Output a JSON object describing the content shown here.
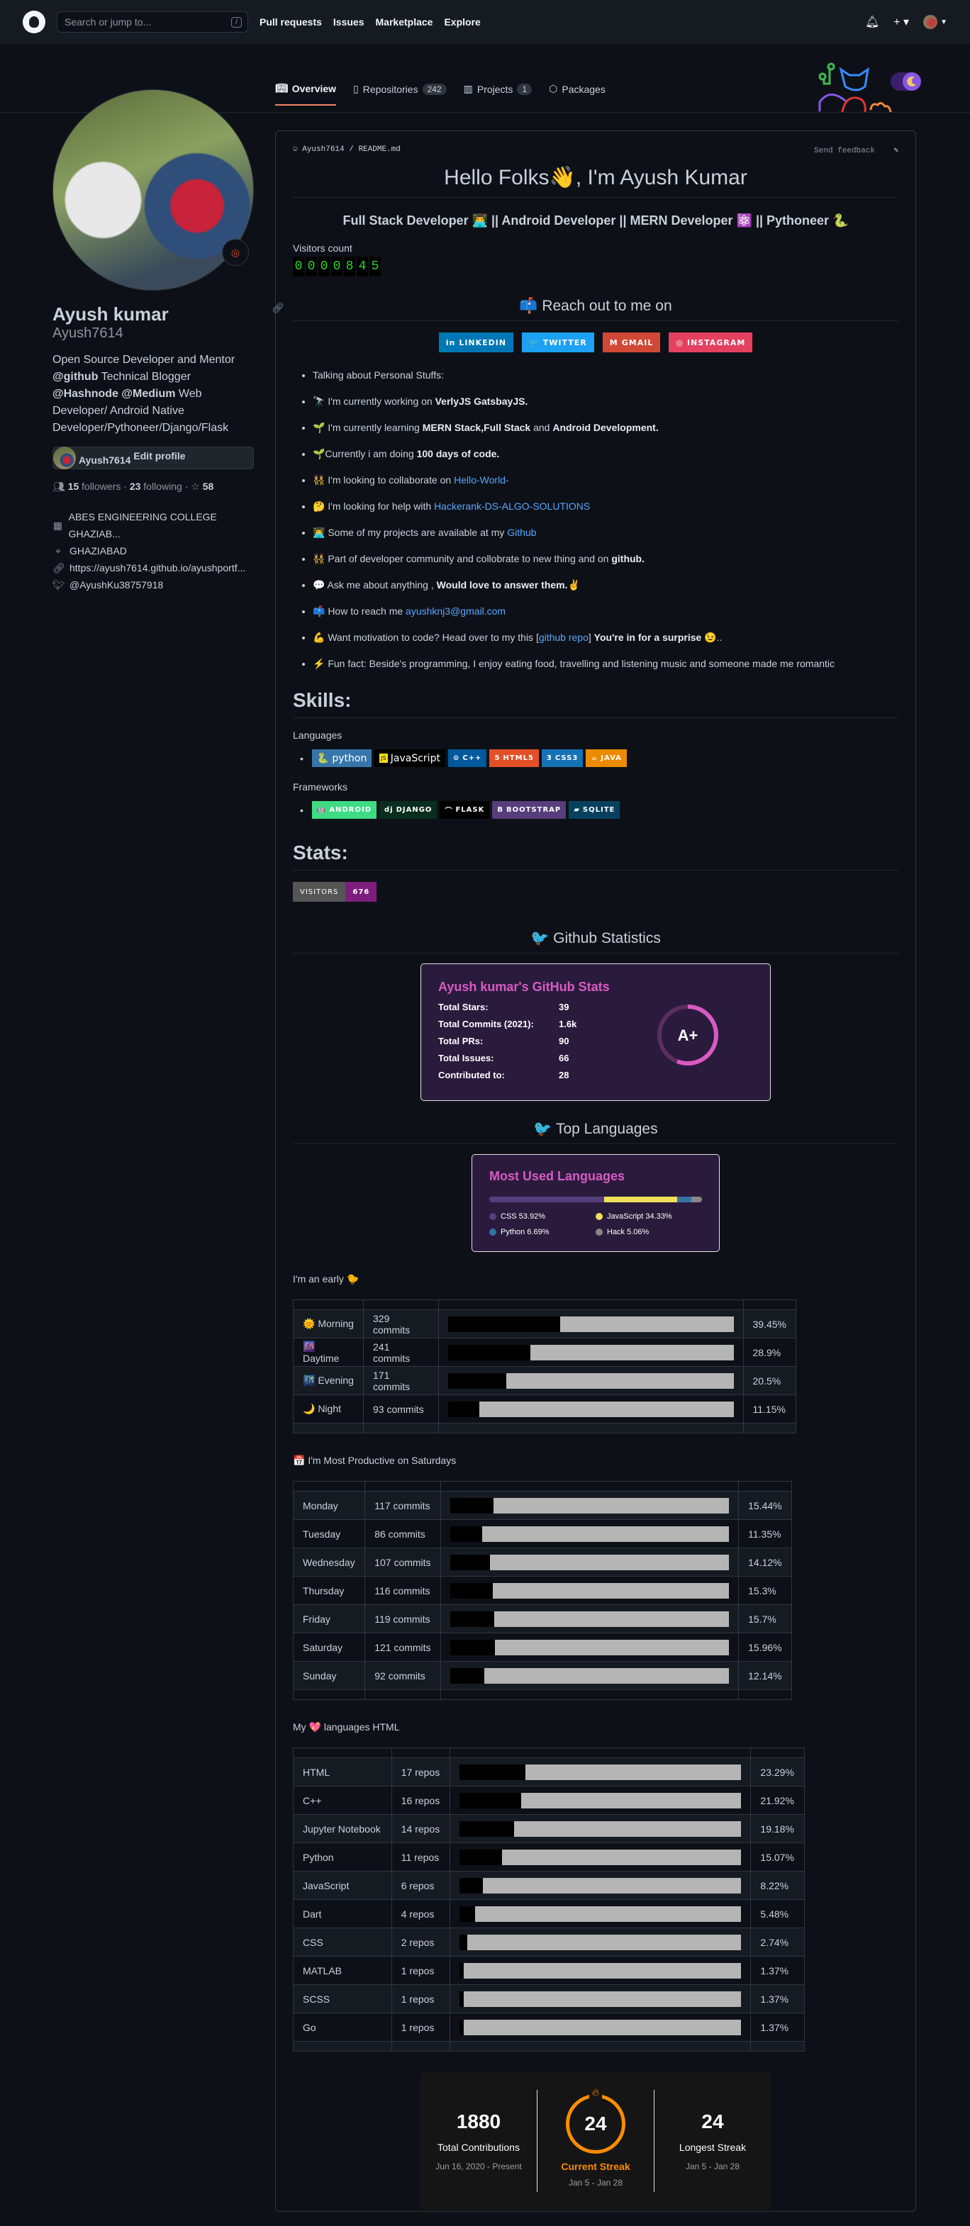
{
  "header": {
    "search_placeholder": "Search or jump to...",
    "slash": "/",
    "nav": [
      "Pull requests",
      "Issues",
      "Marketplace",
      "Explore"
    ]
  },
  "tabs": [
    {
      "label": "Overview"
    },
    {
      "label": "Repositories",
      "count": "242"
    },
    {
      "label": "Projects",
      "count": "1"
    },
    {
      "label": "Packages"
    }
  ],
  "profile": {
    "name": "Ayush kumar",
    "login": "Ayush7614",
    "bio_parts": [
      "Open Source Developer and Mentor ",
      "@github",
      " Technical Blogger ",
      "@Hashnode @Medium",
      " Web Developer/ Android Native Developer/Pythoneer/Django/Flask"
    ],
    "edit_label": "Edit profile",
    "followers": "15",
    "followers_label": "followers",
    "following": "23",
    "following_label": "following",
    "stars": "58",
    "org": "ABES ENGINEERING COLLEGE GHAZIAB...",
    "location": "GHAZIABAD",
    "website": "https://ayush7614.github.io/ayushportf...",
    "twitter": "@AyushKu38757918"
  },
  "readme": {
    "path_user": "Ayush7614",
    "path_file": "README.md",
    "send_feedback": "Send feedback",
    "title": "Hello Folks👋, I'm Ayush Kumar",
    "subtitle": "Full Stack Developer 👨‍💻 || Android Developer || MERN Developer ⚛️ || Pythoneer 🐍",
    "visitors_label": "Visitors count",
    "visitor_digits": [
      "0",
      "0",
      "0",
      "0",
      "8",
      "4",
      "5"
    ],
    "reach_title": "📫 Reach out to me on",
    "socials": [
      {
        "label": "LINKEDIN",
        "icon": "in",
        "color": "#0077b5"
      },
      {
        "label": "TWITTER",
        "icon": "🐦",
        "color": "#1da1f2"
      },
      {
        "label": "GMAIL",
        "icon": "M",
        "color": "#d14836"
      },
      {
        "label": "INSTAGRAM",
        "icon": "◎",
        "color": "#e4405f"
      }
    ],
    "about": [
      {
        "pre": "Talking about Personal Stuffs:"
      },
      {
        "pre": "🔭 I'm currently working on ",
        "bold": "VerlyJS GatsbayJS."
      },
      {
        "pre": "🌱 I'm currently learning ",
        "bold": "MERN Stack,Full Stack",
        "mid": " and ",
        "bold2": "Android Development."
      },
      {
        "pre": "🌱Currently i am doing ",
        "bold": "100 days of code."
      },
      {
        "pre": "👯 I'm looking to collaborate on ",
        "link": "Hello-World-"
      },
      {
        "pre": "🤔 I'm looking for help with ",
        "link": "Hackerank-DS-ALGO-SOLUTIONS"
      },
      {
        "pre": "👨‍💻 Some of my projects are available at my ",
        "link": "Github"
      },
      {
        "pre": "👯 Part of developer community and collobrate to new thing and on ",
        "bold": "github."
      },
      {
        "pre": "💬 Ask me about anything , ",
        "bold": "Would love to answer them.✌️"
      },
      {
        "pre": "📫 How to reach me ",
        "link": "ayushknj3@gmail.com"
      },
      {
        "pre": "💪 Want motivation to code? Head over to my this [",
        "link": "github repo",
        "mid": "] ",
        "bold": "You're in for a surprise 😉",
        "post": ".."
      },
      {
        "pre": "⚡ Fun fact: Beside's programming, I enjoy eating food, travelling and listening music and someone made me romantic"
      }
    ],
    "skills_title": "Skills:",
    "languages_label": "Languages",
    "frameworks_label": "Frameworks",
    "languages": [
      {
        "label": "python",
        "color": "#3776ab",
        "icon": "🐍"
      },
      {
        "label": "JavaScript",
        "color": "#000000",
        "icon": "JS"
      },
      {
        "label": "C++",
        "color": "#00599c",
        "icon": "⊙"
      },
      {
        "label": "HTML5",
        "color": "#e34f26",
        "icon": "5"
      },
      {
        "label": "CSS3",
        "color": "#1572b6",
        "icon": "3"
      },
      {
        "label": "JAVA",
        "color": "#ed8b00",
        "icon": "☕"
      }
    ],
    "frameworks": [
      {
        "label": "ANDROID",
        "color": "#3ddc84",
        "icon": "🤖"
      },
      {
        "label": "DJANGO",
        "color": "#092e20",
        "icon": "dj"
      },
      {
        "label": "FLASK",
        "color": "#000000",
        "icon": "⌒"
      },
      {
        "label": "BOOTSTRAP",
        "color": "#563d7c",
        "icon": "B"
      },
      {
        "label": "SQLITE",
        "color": "#07405e",
        "icon": "▰"
      }
    ],
    "stats_title": "Stats:",
    "visitors_badge": {
      "label": "VISITORS",
      "value": "676"
    },
    "gh_stats_title": "🐦 Github Statistics",
    "stat_card": {
      "title": "Ayush kumar's GitHub Stats",
      "rows": [
        {
          "k": "Total Stars:",
          "v": "39"
        },
        {
          "k": "Total Commits (2021):",
          "v": "1.6k"
        },
        {
          "k": "Total PRs:",
          "v": "90"
        },
        {
          "k": "Total Issues:",
          "v": "66"
        },
        {
          "k": "Contributed to:",
          "v": "28"
        }
      ],
      "grade": "A+",
      "grade_progress": 0.56
    },
    "top_lang_title": "🐦 Top Languages",
    "lang_card": {
      "title": "Most Used Languages",
      "items": [
        {
          "name": "CSS",
          "pct": 53.92,
          "label": "CSS 53.92%",
          "color": "#563d7c"
        },
        {
          "name": "JavaScript",
          "pct": 34.33,
          "label": "JavaScript 34.33%",
          "color": "#f1e05a"
        },
        {
          "name": "Python",
          "pct": 6.69,
          "label": "Python 6.69%",
          "color": "#3572a5"
        },
        {
          "name": "Hack",
          "pct": 5.06,
          "label": "Hack 5.06%",
          "color": "#878787"
        }
      ]
    },
    "early_title": "I'm an early 🐤",
    "times": [
      {
        "name": "🌞 Morning",
        "count": "329 commits",
        "pct": 39.45,
        "pct_label": "39.45%"
      },
      {
        "name": "🌆 Daytime",
        "count": "241 commits",
        "pct": 28.9,
        "pct_label": "28.9%"
      },
      {
        "name": "🌃 Evening",
        "count": "171 commits",
        "pct": 20.5,
        "pct_label": "20.5%"
      },
      {
        "name": "🌙 Night",
        "count": "93 commits",
        "pct": 11.15,
        "pct_label": "11.15%"
      }
    ],
    "days_title": "📅 I'm Most Productive on Saturdays",
    "days": [
      {
        "name": "Monday",
        "count": "117 commits",
        "pct": 15.44,
        "pct_label": "15.44%"
      },
      {
        "name": "Tuesday",
        "count": "86 commits",
        "pct": 11.35,
        "pct_label": "11.35%"
      },
      {
        "name": "Wednesday",
        "count": "107 commits",
        "pct": 14.12,
        "pct_label": "14.12%"
      },
      {
        "name": "Thursday",
        "count": "116 commits",
        "pct": 15.3,
        "pct_label": "15.3%"
      },
      {
        "name": "Friday",
        "count": "119 commits",
        "pct": 15.7,
        "pct_label": "15.7%"
      },
      {
        "name": "Saturday",
        "count": "121 commits",
        "pct": 15.96,
        "pct_label": "15.96%"
      },
      {
        "name": "Sunday",
        "count": "92 commits",
        "pct": 12.14,
        "pct_label": "12.14%"
      }
    ],
    "langs_title": "My 💖 languages HTML",
    "repo_langs": [
      {
        "name": "HTML",
        "count": "17 repos",
        "pct": 23.29,
        "pct_label": "23.29%"
      },
      {
        "name": "C++",
        "count": "16 repos",
        "pct": 21.92,
        "pct_label": "21.92%"
      },
      {
        "name": "Jupyter Notebook",
        "count": "14 repos",
        "pct": 19.18,
        "pct_label": "19.18%"
      },
      {
        "name": "Python",
        "count": "11 repos",
        "pct": 15.07,
        "pct_label": "15.07%"
      },
      {
        "name": "JavaScript",
        "count": "6 repos",
        "pct": 8.22,
        "pct_label": "8.22%"
      },
      {
        "name": "Dart",
        "count": "4 repos",
        "pct": 5.48,
        "pct_label": "5.48%"
      },
      {
        "name": "CSS",
        "count": "2 repos",
        "pct": 2.74,
        "pct_label": "2.74%"
      },
      {
        "name": "MATLAB",
        "count": "1 repos",
        "pct": 1.37,
        "pct_label": "1.37%"
      },
      {
        "name": "SCSS",
        "count": "1 repos",
        "pct": 1.37,
        "pct_label": "1.37%"
      },
      {
        "name": "Go",
        "count": "1 repos",
        "pct": 1.37,
        "pct_label": "1.37%"
      }
    ],
    "streak": {
      "total": "1880",
      "total_label": "Total Contributions",
      "total_range": "Jun 16, 2020 - Present",
      "current": "24",
      "current_label": "Current Streak",
      "current_range": "Jan 5 - Jan 28",
      "longest": "24",
      "longest_label": "Longest Streak",
      "longest_range": "Jan 5 - Jan 28"
    }
  }
}
